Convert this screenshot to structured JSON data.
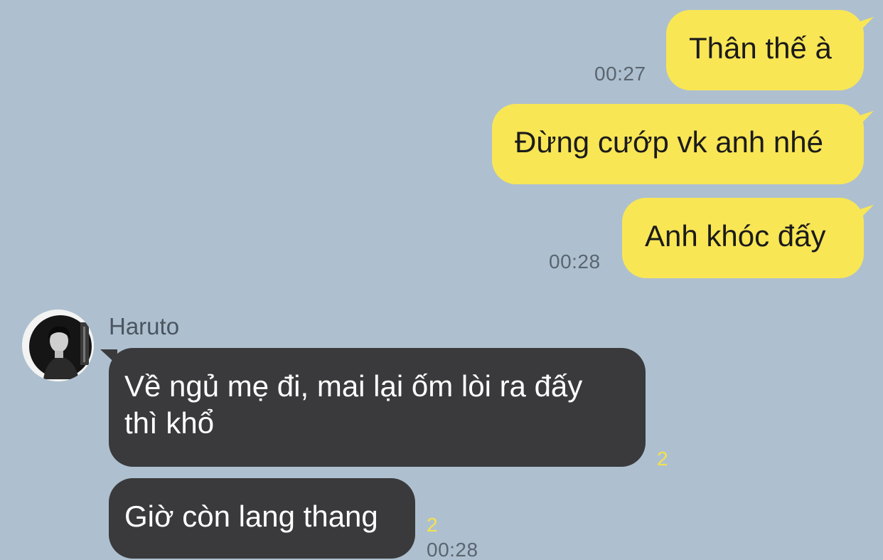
{
  "conversation": {
    "sender_name": "Haruto",
    "outgoing": [
      {
        "text": "Thân thế à",
        "time": "00:27"
      },
      {
        "text": "Đừng cướp vk anh nhé"
      },
      {
        "text": "Anh khóc đấy",
        "time": "00:28"
      }
    ],
    "incoming": [
      {
        "line1": "Về ngủ mẹ đi, mai lại ốm lòi ra đấy",
        "line2": "thì khổ",
        "unread": "2"
      },
      {
        "text": "Giờ còn lang thang",
        "unread": "2",
        "time": "00:28"
      }
    ]
  },
  "colors": {
    "background": "#aec0cf",
    "outgoing_bubble": "#f8e655",
    "incoming_bubble": "#3a3a3c",
    "unread_count": "#f4e14d"
  },
  "icons": {
    "avatar": "profile-photo"
  }
}
